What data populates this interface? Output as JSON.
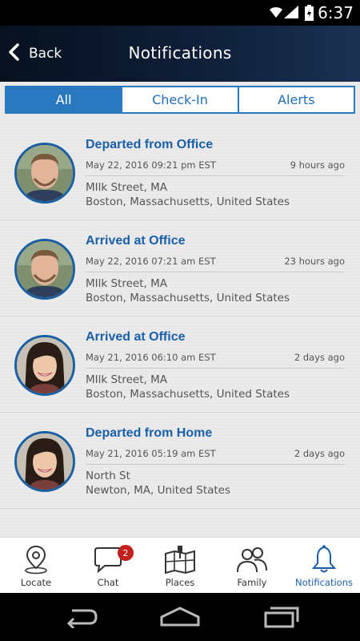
{
  "status_bar": {
    "time": "6:37",
    "icons": [
      "wifi-icon",
      "signal-icon",
      "battery-charging-icon"
    ]
  },
  "header": {
    "back_label": "Back",
    "title": "Notifications"
  },
  "tabs": [
    {
      "label": "All",
      "active": true
    },
    {
      "label": "Check-In",
      "active": false
    },
    {
      "label": "Alerts",
      "active": false
    }
  ],
  "notifications": [
    {
      "title": "Departed from Office",
      "date": "May 22, 2016 09:21 pm EST",
      "ago": "9 hours ago",
      "address_line1": "MIlk Street, MA",
      "address_line2": "Boston, Massachusetts, United States",
      "avatar": "man-avatar"
    },
    {
      "title": "Arrived at Office",
      "date": "May 22, 2016 07:21 am EST",
      "ago": "23 hours ago",
      "address_line1": "MIlk Street, MA",
      "address_line2": "Boston, Massachusetts, United States",
      "avatar": "man-avatar"
    },
    {
      "title": "Arrived at Office",
      "date": "May 21, 2016 06:10 am EST",
      "ago": "2 days ago",
      "address_line1": "MIlk Street, MA",
      "address_line2": "Boston, Massachusetts, United States",
      "avatar": "woman-avatar"
    },
    {
      "title": "Departed from Home",
      "date": "May 21, 2016 05:19 am EST",
      "ago": "2 days ago",
      "address_line1": "North St",
      "address_line2": "Newton, MA, United States",
      "avatar": "woman-avatar"
    }
  ],
  "bottom_nav": [
    {
      "label": "Locate",
      "icon": "location-pin-icon"
    },
    {
      "label": "Chat",
      "icon": "chat-bubble-icon",
      "badge": "2"
    },
    {
      "label": "Places",
      "icon": "map-icon"
    },
    {
      "label": "Family",
      "icon": "family-icon"
    },
    {
      "label": "Notifications",
      "icon": "bell-icon",
      "active": true
    }
  ],
  "colors": {
    "accent": "#2a78c0",
    "title_blue": "#1a5fa8",
    "badge_red": "#c3201d",
    "header_dark": "#0f1f38"
  },
  "system_nav": [
    "back-nav-icon",
    "home-nav-icon",
    "recents-nav-icon"
  ]
}
